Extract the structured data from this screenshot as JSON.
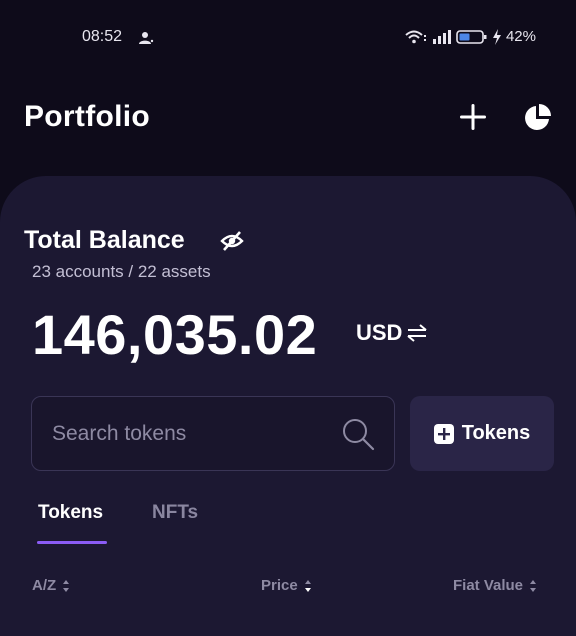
{
  "status_bar": {
    "time": "08:52",
    "battery": "42%"
  },
  "header": {
    "title": "Portfolio",
    "icons": [
      "add-icon",
      "pie-chart-icon"
    ]
  },
  "balance": {
    "title": "Total Balance",
    "accounts_summary": "23 accounts / 22 assets",
    "amount": "146,035.02",
    "currency": "USD"
  },
  "search": {
    "placeholder": "Search tokens",
    "value": ""
  },
  "add_tokens_button": {
    "label": "Tokens"
  },
  "tabs": [
    {
      "label": "Tokens",
      "active": true
    },
    {
      "label": "NFTs",
      "active": false
    }
  ],
  "sort_headers": [
    {
      "label": "A/Z"
    },
    {
      "label": "Price"
    },
    {
      "label": "Fiat Value"
    }
  ],
  "colors": {
    "background": "#0e0b1a",
    "panel": "#1c1832",
    "accent": "#8b5cf6",
    "muted_text": "#8e8aa3"
  }
}
